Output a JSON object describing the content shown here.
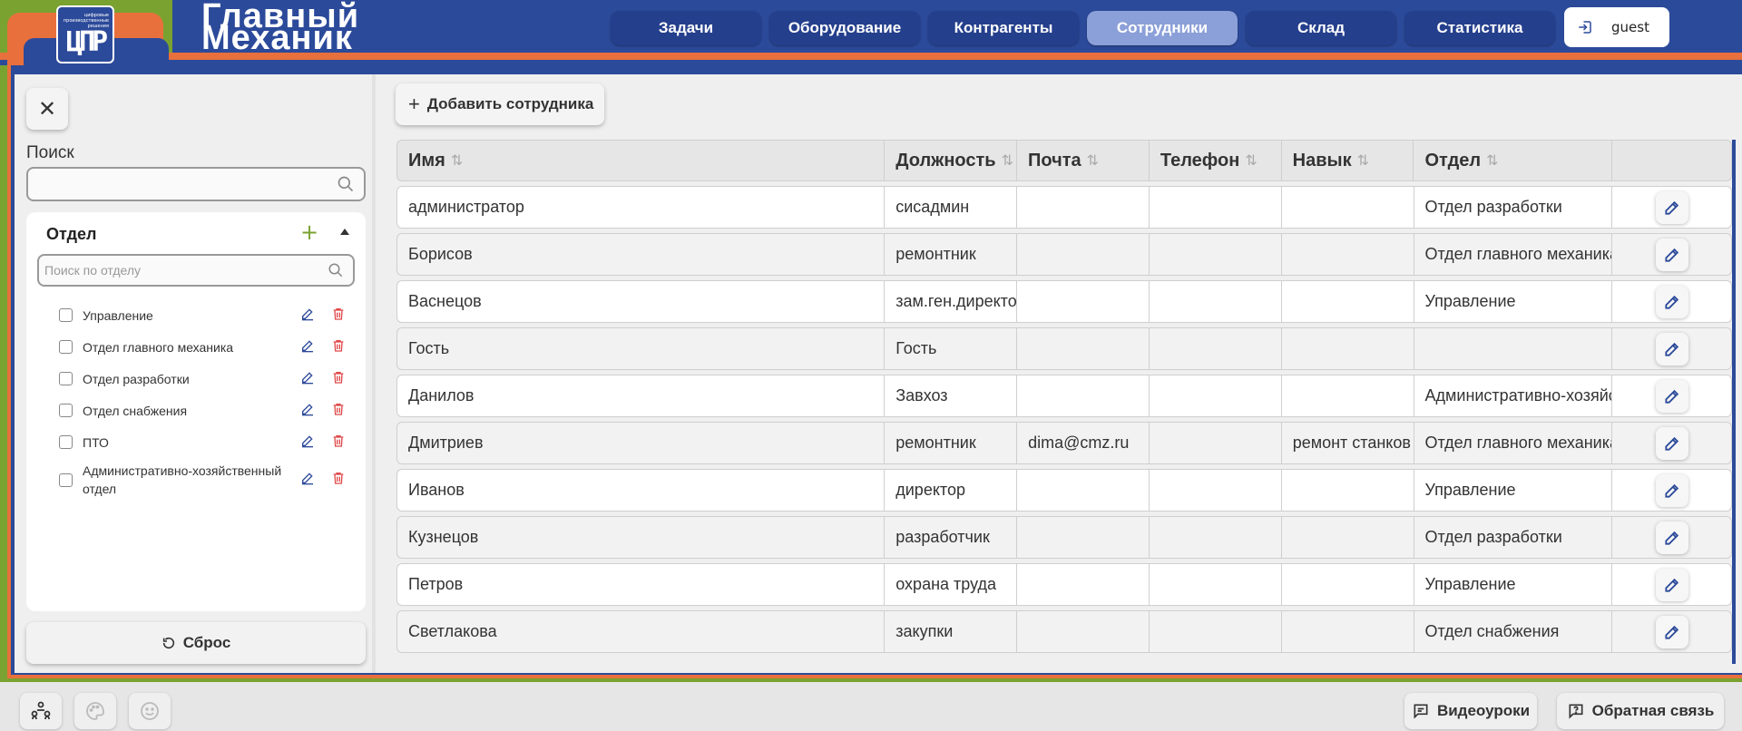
{
  "header": {
    "logo_small": "цифровые производственные решения",
    "logo_big": "ЦПР",
    "brand_line1": "Главный",
    "brand_line2": "Механик",
    "nav": [
      "Задачи",
      "Оборудование",
      "Контрагенты",
      "Сотрудники",
      "Склад",
      "Статистика"
    ],
    "active_nav": "Сотрудники",
    "user": "guest"
  },
  "sidebar": {
    "search_label": "Поиск",
    "search_value": "",
    "dept_title": "Отдел",
    "dept_search_placeholder": "Поиск по отделу",
    "departments": [
      "Управление",
      "Отдел главного механика",
      "Отдел разработки",
      "Отдел снабжения",
      "ПТО",
      "Административно-хозяйственный отдел"
    ],
    "reset_label": "Сброс"
  },
  "main": {
    "add_button": "Добавить сотрудника",
    "columns": [
      "Имя",
      "Должность",
      "Почта",
      "Телефон",
      "Навык",
      "Отдел"
    ],
    "rows": [
      [
        "администратор",
        "сисадмин",
        "",
        "",
        "",
        "Отдел разработки"
      ],
      [
        "Борисов",
        "ремонтник",
        "",
        "",
        "",
        "Отдел главного механика"
      ],
      [
        "Васнецов",
        "зам.ген.директора",
        "",
        "",
        "",
        "Управление"
      ],
      [
        "Гость",
        "Гость",
        "",
        "",
        "",
        ""
      ],
      [
        "Данилов",
        "Завхоз",
        "",
        "",
        "",
        "Административно-хозяйственный отдел"
      ],
      [
        "Дмитриев",
        "ремонтник",
        "dima@cmz.ru",
        "",
        "ремонт станков",
        "Отдел главного механика"
      ],
      [
        "Иванов",
        "директор",
        "",
        "",
        "",
        "Управление"
      ],
      [
        "Кузнецов",
        "разработчик",
        "",
        "",
        "",
        "Отдел разработки"
      ],
      [
        "Петров",
        "охрана труда",
        "",
        "",
        "",
        "Управление"
      ],
      [
        "Светлакова",
        "закупки",
        "",
        "",
        "",
        "Отдел снабжения"
      ]
    ]
  },
  "footer": {
    "video_label": "Видеоуроки",
    "feedback_label": "Обратная связь"
  },
  "colors": {
    "header_blue": "#2c4a9a",
    "accent_orange": "#e8703c",
    "accent_green": "#7aa230",
    "active_nav": "#8b9fd8",
    "trash_red": "#e04848"
  }
}
